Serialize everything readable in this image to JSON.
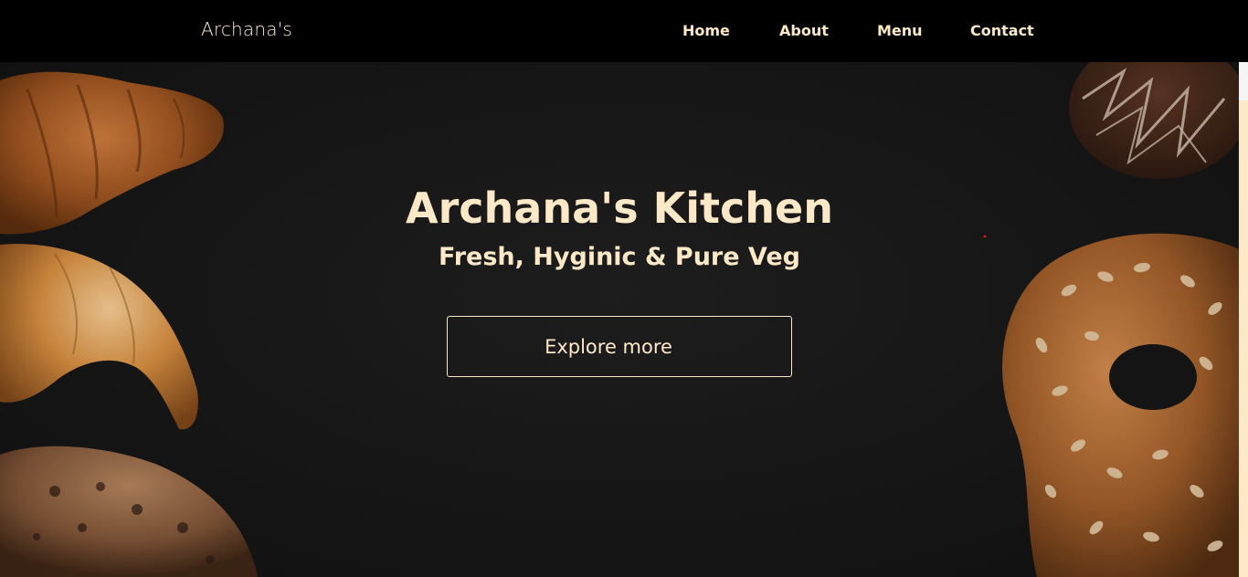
{
  "navbar": {
    "brand": "Archana's",
    "links": [
      {
        "label": "Home"
      },
      {
        "label": "About"
      },
      {
        "label": "Menu"
      },
      {
        "label": "Contact"
      }
    ]
  },
  "hero": {
    "title": "Archana's Kitchen",
    "subtitle": "Fresh, Hyginic & Pure Veg",
    "button_label": "Explore more"
  },
  "colors": {
    "navbar_bg": "#000000",
    "accent_text": "#fde8c8",
    "hero_bg": "#151515"
  }
}
